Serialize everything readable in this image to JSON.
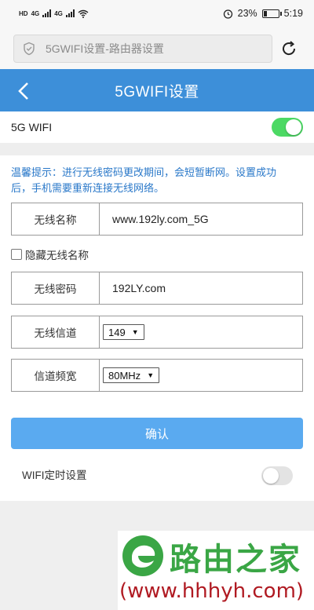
{
  "status_bar": {
    "left_labels": [
      "HD",
      "4G",
      "4G"
    ],
    "battery_percent_text": "23%",
    "battery_level": 0.23,
    "time": "5:19"
  },
  "browser": {
    "address_text": "5GWIFI设置-路由器设置",
    "icons": [
      "shield-icon",
      "reload-icon"
    ]
  },
  "header": {
    "title": "5GWIFI设置",
    "back_icon": "chevron-left-icon"
  },
  "wifi_5g": {
    "label": "5G WIFI",
    "enabled": true
  },
  "form": {
    "tip": "温馨提示：进行无线密码更改期间，会短暂断网。设置成功后，手机需要重新连接无线网络。",
    "ssid_label": "无线名称",
    "ssid_value": "www.192ly.com_5G",
    "hide_ssid_label": "隐藏无线名称",
    "hide_ssid_checked": false,
    "password_label": "无线密码",
    "password_value": "192LY.com",
    "channel_label": "无线信道",
    "channel_value": "149",
    "bandwidth_label": "信道频宽",
    "bandwidth_value": "80MHz",
    "confirm_label": "确认",
    "timer_label": "WIFI定时设置",
    "timer_enabled": false
  },
  "watermark": {
    "brand": "路由之家",
    "url": "(www.hhhyh.com)"
  },
  "colors": {
    "header_blue": "#3d8fd9",
    "button_blue": "#5aaaf0",
    "toggle_green": "#4cd964",
    "tip_blue": "#2a78c9"
  }
}
